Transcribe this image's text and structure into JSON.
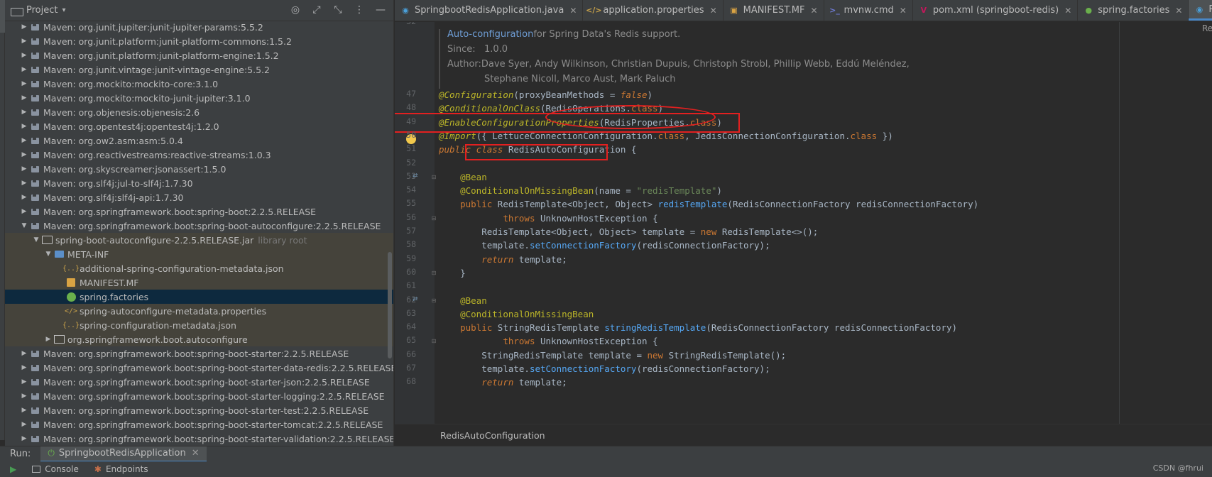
{
  "project_panel": {
    "title": "Project",
    "tree": [
      {
        "depth": 0,
        "arrow": "▶",
        "icon": "library-icon",
        "label": "Maven: org.junit.jupiter:junit-jupiter-params:5.5.2"
      },
      {
        "depth": 0,
        "arrow": "▶",
        "icon": "library-icon",
        "label": "Maven: org.junit.platform:junit-platform-commons:1.5.2"
      },
      {
        "depth": 0,
        "arrow": "▶",
        "icon": "library-icon",
        "label": "Maven: org.junit.platform:junit-platform-engine:1.5.2"
      },
      {
        "depth": 0,
        "arrow": "▶",
        "icon": "library-icon",
        "label": "Maven: org.junit.vintage:junit-vintage-engine:5.5.2"
      },
      {
        "depth": 0,
        "arrow": "▶",
        "icon": "library-icon",
        "label": "Maven: org.mockito:mockito-core:3.1.0"
      },
      {
        "depth": 0,
        "arrow": "▶",
        "icon": "library-icon",
        "label": "Maven: org.mockito:mockito-junit-jupiter:3.1.0"
      },
      {
        "depth": 0,
        "arrow": "▶",
        "icon": "library-icon",
        "label": "Maven: org.objenesis:objenesis:2.6"
      },
      {
        "depth": 0,
        "arrow": "▶",
        "icon": "library-icon",
        "label": "Maven: org.opentest4j:opentest4j:1.2.0"
      },
      {
        "depth": 0,
        "arrow": "▶",
        "icon": "library-icon",
        "label": "Maven: org.ow2.asm:asm:5.0.4"
      },
      {
        "depth": 0,
        "arrow": "▶",
        "icon": "library-icon",
        "label": "Maven: org.reactivestreams:reactive-streams:1.0.3"
      },
      {
        "depth": 0,
        "arrow": "▶",
        "icon": "library-icon",
        "label": "Maven: org.skyscreamer:jsonassert:1.5.0"
      },
      {
        "depth": 0,
        "arrow": "▶",
        "icon": "library-icon",
        "label": "Maven: org.slf4j:jul-to-slf4j:1.7.30"
      },
      {
        "depth": 0,
        "arrow": "▶",
        "icon": "library-icon",
        "label": "Maven: org.slf4j:slf4j-api:1.7.30"
      },
      {
        "depth": 0,
        "arrow": "▶",
        "icon": "library-icon",
        "label": "Maven: org.springframework.boot:spring-boot:2.2.5.RELEASE"
      },
      {
        "depth": 0,
        "arrow": "▼",
        "icon": "library-icon",
        "label": "Maven: org.springframework.boot:spring-boot-autoconfigure:2.2.5.RELEASE"
      },
      {
        "depth": 1,
        "arrow": "▼",
        "icon": "folder-icon",
        "label": "spring-boot-autoconfigure-2.2.5.RELEASE.jar",
        "suffix": "library root",
        "hl": true
      },
      {
        "depth": 2,
        "arrow": "▼",
        "icon": "folder-blue-icon",
        "label": "META-INF",
        "hl": true
      },
      {
        "depth": 3,
        "arrow": "",
        "icon": "json-icon",
        "label": "additional-spring-configuration-metadata.json",
        "hl": true
      },
      {
        "depth": 3,
        "arrow": "",
        "icon": "manifest-icon",
        "label": "MANIFEST.MF",
        "hl": true
      },
      {
        "depth": 3,
        "arrow": "",
        "icon": "spring-icon",
        "label": "spring.factories",
        "sel": true
      },
      {
        "depth": 3,
        "arrow": "",
        "icon": "properties-icon",
        "label": "spring-autoconfigure-metadata.properties",
        "hl": true
      },
      {
        "depth": 3,
        "arrow": "",
        "icon": "json-icon",
        "label": "spring-configuration-metadata.json",
        "hl": true
      },
      {
        "depth": 2,
        "arrow": "▶",
        "icon": "package-icon",
        "label": "org.springframework.boot.autoconfigure",
        "hl": true
      },
      {
        "depth": 0,
        "arrow": "▶",
        "icon": "library-icon",
        "label": "Maven: org.springframework.boot:spring-boot-starter:2.2.5.RELEASE"
      },
      {
        "depth": 0,
        "arrow": "▶",
        "icon": "library-icon",
        "label": "Maven: org.springframework.boot:spring-boot-starter-data-redis:2.2.5.RELEASE"
      },
      {
        "depth": 0,
        "arrow": "▶",
        "icon": "library-icon",
        "label": "Maven: org.springframework.boot:spring-boot-starter-json:2.2.5.RELEASE"
      },
      {
        "depth": 0,
        "arrow": "▶",
        "icon": "library-icon",
        "label": "Maven: org.springframework.boot:spring-boot-starter-logging:2.2.5.RELEASE"
      },
      {
        "depth": 0,
        "arrow": "▶",
        "icon": "library-icon",
        "label": "Maven: org.springframework.boot:spring-boot-starter-test:2.2.5.RELEASE"
      },
      {
        "depth": 0,
        "arrow": "▶",
        "icon": "library-icon",
        "label": "Maven: org.springframework.boot:spring-boot-starter-tomcat:2.2.5.RELEASE"
      },
      {
        "depth": 0,
        "arrow": "▶",
        "icon": "library-icon",
        "label": "Maven: org.springframework.boot:spring-boot-starter-validation:2.2.5.RELEASE"
      }
    ]
  },
  "editor_tabs": [
    {
      "label": "SpringbootRedisApplication.java",
      "icon": "java-class-icon",
      "icon_text": "◉",
      "icon_color": "#4a9fd8",
      "active": false
    },
    {
      "label": "application.properties",
      "icon": "properties-icon",
      "icon_text": "</>",
      "icon_color": "#c9a24a",
      "active": false
    },
    {
      "label": "MANIFEST.MF",
      "icon": "manifest-icon",
      "icon_text": "▣",
      "icon_color": "#d9a343",
      "active": false
    },
    {
      "label": "mvnw.cmd",
      "icon": "cmd-icon",
      "icon_text": ">_",
      "icon_color": "#6f7bd6",
      "active": false
    },
    {
      "label": "pom.xml (springboot-redis)",
      "icon": "maven-icon",
      "icon_text": "V",
      "icon_color": "#c2185b",
      "active": false
    },
    {
      "label": "spring.factories",
      "icon": "spring-icon",
      "icon_text": "●",
      "icon_color": "#6ab04c",
      "active": false
    },
    {
      "label": "RedisAutoConfigura",
      "icon": "java-class-icon",
      "icon_text": "◉",
      "icon_color": "#4a9fd8",
      "active": true
    }
  ],
  "doc": {
    "link": "Auto-configuration",
    "summary": " for Spring Data's Redis support.",
    "since_label": "Since:",
    "since_value": "1.0.0",
    "author_label": "Author:",
    "author_line1": "Dave Syer, Andy Wilkinson, Christian Dupuis, Christoph Strobl, Phillip Webb, Eddú Meléndez,",
    "author_line2": "Stephane Nicoll, Marco Aust, Mark Paluch"
  },
  "gutter_top_number": "32",
  "code_lines": [
    {
      "n": "47",
      "tokens": [
        [
          "anno",
          "@Configuration"
        ],
        [
          "gen",
          "(proxyBeanMethods = "
        ],
        [
          "kwi",
          "false"
        ],
        [
          "gen",
          ")"
        ]
      ]
    },
    {
      "n": "48",
      "tokens": [
        [
          "anno",
          "@ConditionalOnClass"
        ],
        [
          "gen",
          "(RedisOperations."
        ],
        [
          "kw",
          "class"
        ],
        [
          "gen",
          ")"
        ]
      ]
    },
    {
      "n": "49",
      "tokens": [
        [
          "anno",
          "@EnableConfigurationProperties"
        ],
        [
          "gen",
          "(RedisProperties."
        ],
        [
          "kw",
          "class"
        ],
        [
          "gen",
          ")"
        ]
      ]
    },
    {
      "n": "50",
      "tokens": [
        [
          "anno",
          "@Import"
        ],
        [
          "gen",
          "({ LettuceConnectionConfiguration."
        ],
        [
          "kw",
          "class"
        ],
        [
          "gen",
          ", JedisConnectionConfiguration."
        ],
        [
          "kw",
          "class"
        ],
        [
          "gen",
          " })"
        ]
      ]
    },
    {
      "n": "51",
      "tokens": [
        [
          "kwi",
          "public class "
        ],
        [
          "gen",
          "RedisAutoConfiguration {"
        ]
      ]
    },
    {
      "n": "52",
      "tokens": []
    },
    {
      "n": "53",
      "tokens": [
        [
          "gen",
          "    "
        ],
        [
          "anno-n",
          "@Bean"
        ]
      ]
    },
    {
      "n": "54",
      "tokens": [
        [
          "gen",
          "    "
        ],
        [
          "anno-n",
          "@ConditionalOnMissingBean"
        ],
        [
          "gen",
          "(name = "
        ],
        [
          "str",
          "\"redisTemplate\""
        ],
        [
          "gen",
          ")"
        ]
      ]
    },
    {
      "n": "55",
      "tokens": [
        [
          "gen",
          "    "
        ],
        [
          "kw",
          "public "
        ],
        [
          "gen",
          "RedisTemplate<Object, Object> "
        ],
        [
          "call",
          "redisTemplate"
        ],
        [
          "gen",
          "(RedisConnectionFactory redisConnectionFactory)"
        ]
      ]
    },
    {
      "n": "56",
      "tokens": [
        [
          "gen",
          "            "
        ],
        [
          "kw",
          "throws "
        ],
        [
          "gen",
          "UnknownHostException {"
        ]
      ]
    },
    {
      "n": "57",
      "tokens": [
        [
          "gen",
          "        RedisTemplate<Object, Object> template = "
        ],
        [
          "kw",
          "new "
        ],
        [
          "gen",
          "RedisTemplate<>();"
        ]
      ]
    },
    {
      "n": "58",
      "tokens": [
        [
          "gen",
          "        template."
        ],
        [
          "call",
          "setConnectionFactory"
        ],
        [
          "gen",
          "(redisConnectionFactory);"
        ]
      ]
    },
    {
      "n": "59",
      "tokens": [
        [
          "gen",
          "        "
        ],
        [
          "kwi",
          "return "
        ],
        [
          "gen",
          "template;"
        ]
      ]
    },
    {
      "n": "60",
      "tokens": [
        [
          "gen",
          "    }"
        ]
      ]
    },
    {
      "n": "61",
      "tokens": []
    },
    {
      "n": "62",
      "tokens": [
        [
          "gen",
          "    "
        ],
        [
          "anno-n",
          "@Bean"
        ]
      ]
    },
    {
      "n": "63",
      "tokens": [
        [
          "gen",
          "    "
        ],
        [
          "anno-n",
          "@ConditionalOnMissingBean"
        ]
      ]
    },
    {
      "n": "64",
      "tokens": [
        [
          "gen",
          "    "
        ],
        [
          "kw",
          "public "
        ],
        [
          "gen",
          "StringRedisTemplate "
        ],
        [
          "call",
          "stringRedisTemplate"
        ],
        [
          "gen",
          "(RedisConnectionFactory redisConnectionFactory)"
        ]
      ]
    },
    {
      "n": "65",
      "tokens": [
        [
          "gen",
          "            "
        ],
        [
          "kw",
          "throws "
        ],
        [
          "gen",
          "UnknownHostException {"
        ]
      ]
    },
    {
      "n": "66",
      "tokens": [
        [
          "gen",
          "        StringRedisTemplate template = "
        ],
        [
          "kw",
          "new "
        ],
        [
          "gen",
          "StringRedisTemplate();"
        ]
      ]
    },
    {
      "n": "67",
      "tokens": [
        [
          "gen",
          "        template."
        ],
        [
          "call",
          "setConnectionFactory"
        ],
        [
          "gen",
          "(redisConnectionFactory);"
        ]
      ]
    },
    {
      "n": "68",
      "tokens": [
        [
          "gen",
          "        "
        ],
        [
          "kwi",
          "return "
        ],
        [
          "gen",
          "template;"
        ]
      ]
    }
  ],
  "breadcrumb": "RedisAutoConfiguration",
  "run_bar": {
    "label": "Run:",
    "tab": "SpringbootRedisApplication"
  },
  "bottom_tabs": [
    "Console",
    "Endpoints"
  ],
  "watermark": "CSDN @fhrui",
  "side_label": "Re",
  "colors": {
    "accent": "#4a88c7",
    "annotation_red": "#e32020",
    "selection": "#0d293e"
  }
}
